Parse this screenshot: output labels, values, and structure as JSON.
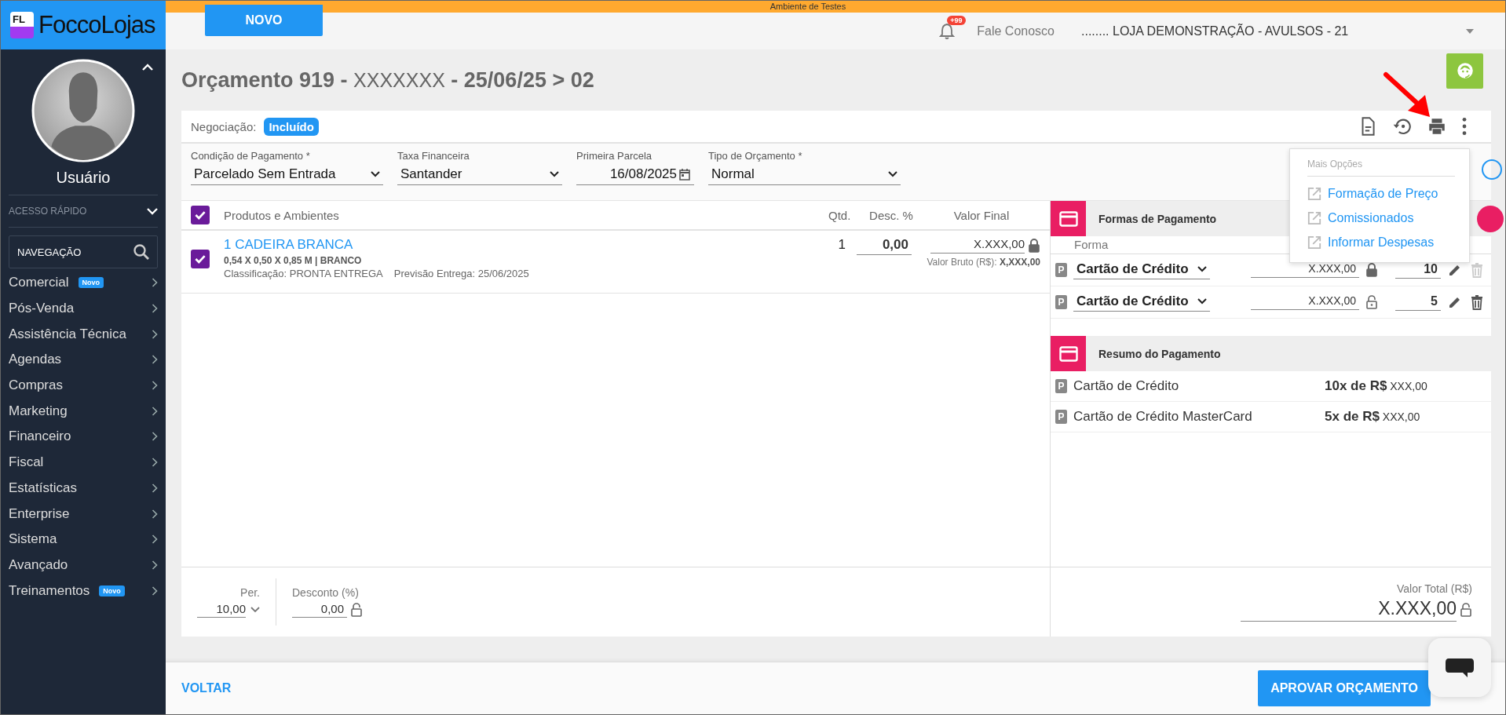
{
  "sidebar": {
    "logo_letters": "FL",
    "brand": "FoccoLojas",
    "user_name": "Usuário",
    "quick_access": {
      "label": "ACESSO RÁPIDO",
      "expanded": false
    },
    "search": {
      "placeholder": "NAVEGAÇÃO"
    },
    "nav_items": [
      {
        "label": "Comercial",
        "badge": "Novo"
      },
      {
        "label": "Pós-Venda"
      },
      {
        "label": "Assistência Técnica"
      },
      {
        "label": "Agendas"
      },
      {
        "label": "Compras"
      },
      {
        "label": "Marketing"
      },
      {
        "label": "Financeiro"
      },
      {
        "label": "Fiscal"
      },
      {
        "label": "Estatísticas"
      },
      {
        "label": "Enterprise"
      },
      {
        "label": "Sistema"
      },
      {
        "label": "Avançado"
      },
      {
        "label": "Treinamentos",
        "badge": "Novo"
      }
    ]
  },
  "banner": "Ambiente de Testes",
  "header": {
    "new_button": "NOVO",
    "notification_count": "+99",
    "contact": "Fale Conosco",
    "store": "........ LOJA DEMONSTRAÇÃO - AVULSOS - 21"
  },
  "title": {
    "prefix": "Orçamento 919 -",
    "name": "XXXXXXX",
    "suffix": "- 25/06/25 > 02"
  },
  "negotiation": {
    "label": "Negociação:",
    "status": "Incluído"
  },
  "fields": [
    {
      "kind": "select",
      "label": "Condição de Pagamento *",
      "value": "Parcelado Sem Entrada"
    },
    {
      "kind": "select",
      "label": "Taxa Financeira",
      "value": "Santander"
    },
    {
      "kind": "date",
      "label": "Primeira Parcela",
      "value": "16/08/2025"
    },
    {
      "kind": "select",
      "label": "Tipo de Orçamento *",
      "value": "Normal"
    }
  ],
  "products": {
    "all_checked": true,
    "columns": [
      "Produtos e Ambientes",
      "Qtd.",
      "Desc. %",
      "Valor Final"
    ],
    "items": [
      {
        "checked": true,
        "name": "1 CADEIRA BRANCA",
        "spec": "0,54 X 0,50 X 0,85 M | BRANCO",
        "classification": "Classificação: PRONTA ENTREGA",
        "delivery": "Previsão Entrega: 25/06/2025",
        "qty": "1",
        "discount": "0,00",
        "final_value": "X.XXX,00",
        "locked": true,
        "gross_label": "Valor Bruto (R$):",
        "gross_value": "X,XXX,00"
      }
    ]
  },
  "payments": {
    "title": "Formas de Pagamento",
    "column": "Forma",
    "rows": [
      {
        "badge": "P",
        "method": "Cartão de Crédito",
        "value": "X.XXX,00",
        "locked": true,
        "installments": "10",
        "delete_disabled": true
      },
      {
        "badge": "P",
        "method": "Cartão de Crédito",
        "value": "X.XXX,00",
        "locked": false,
        "installments": "5",
        "delete_disabled": false
      }
    ]
  },
  "summary": {
    "title": "Resumo do Pagamento",
    "rows": [
      {
        "badge": "P",
        "method": "Cartão de Crédito",
        "installment": "10x de R$",
        "amount": "XXX,00"
      },
      {
        "badge": "P",
        "method": "Cartão de Crédito MasterCard",
        "installment": "5x de R$",
        "amount": "XXX,00"
      }
    ]
  },
  "totals": {
    "period_label": "Per.",
    "period_value": "10,00",
    "discount_label": "Desconto (%)",
    "discount_value": "0,00",
    "discount_locked": false,
    "total_label": "Valor Total (R$)",
    "total_value": "X.XXX,00",
    "total_locked": false
  },
  "menu": {
    "title": "Mais Opções",
    "items": [
      "Formação de Preço",
      "Comissionados",
      "Informar Despesas"
    ]
  },
  "footer": {
    "back": "VOLTAR",
    "approve": "APROVAR ORÇAMENTO"
  }
}
